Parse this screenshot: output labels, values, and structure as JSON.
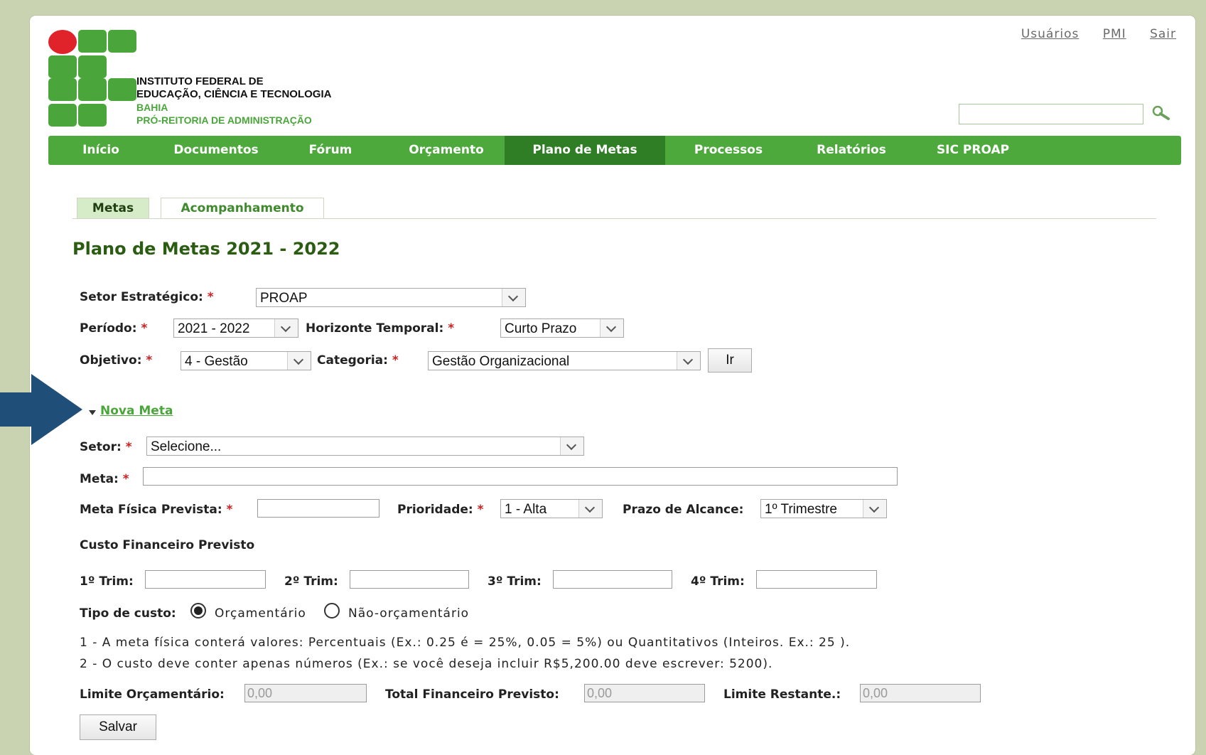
{
  "header": {
    "institution_line1": "INSTITUTO FEDERAL DE",
    "institution_line2": "EDUCAÇÃO, CIÊNCIA E TECNOLOGIA",
    "institution_line3": "BAHIA",
    "department": "PRÓ-REITORIA DE ADMINISTRAÇÃO",
    "top_links": [
      "Usuários",
      "PMI",
      "Sair"
    ],
    "search_value": ""
  },
  "nav": {
    "items": [
      "Início",
      "Documentos",
      "Fórum",
      "Orçamento",
      "Plano de Metas",
      "Processos",
      "Relatórios",
      "SIC PROAP"
    ],
    "active": "Plano de Metas"
  },
  "tabs": [
    "Metas",
    "Acompanhamento"
  ],
  "page_title": "Plano de Metas 2021 - 2022",
  "filters": {
    "setor_label": "Setor Estratégico:",
    "setor_value": "PROAP",
    "periodo_label": "Período:",
    "periodo_value": "2021 - 2022",
    "horizonte_label": "Horizonte Temporal:",
    "horizonte_value": "Curto Prazo",
    "objetivo_label": "Objetivo:",
    "objetivo_value": "4 - Gestão",
    "categoria_label": "Categoria:",
    "categoria_value": "Gestão Organizacional",
    "go_button": "Ir"
  },
  "form": {
    "toggle_label": "Nova Meta",
    "setor_label": "Setor:",
    "setor_value": "Selecione...",
    "meta_label": "Meta:",
    "meta_value": "",
    "meta_fisica_label": "Meta Física Prevista:",
    "meta_fisica_value": "",
    "prioridade_label": "Prioridade:",
    "prioridade_value": "1 - Alta",
    "prazo_label": "Prazo de Alcance:",
    "prazo_value": "1º Trimestre",
    "custo_heading": "Custo Financeiro Previsto",
    "trim_labels": [
      "1º Trim:",
      "2º Trim:",
      "3º Trim:",
      "4º Trim:"
    ],
    "tipo_custo_label": "Tipo de custo:",
    "tipo_options": [
      "Orçamentário",
      "Não-orçamentário"
    ],
    "tipo_selected": "Orçamentário",
    "note1": "1 - A meta física conterá valores: Percentuais (Ex.: 0.25 é = 25%, 0.05 = 5%) ou Quantitativos (Inteiros. Ex.: 25 ).",
    "note2": "2 - O custo deve conter apenas números (Ex.: se você deseja incluir R$5,200.00 deve escrever: 5200).",
    "limite_label": "Limite Orçamentário:",
    "limite_value": "0,00",
    "total_label": "Total Financeiro Previsto:",
    "total_value": "0,00",
    "restante_label": "Limite Restante.:",
    "restante_value": "0,00",
    "save_button": "Salvar"
  },
  "required_mark": "*",
  "colors": {
    "brand_green": "#4ea93d",
    "nav_active": "#2f7d25",
    "logo_red": "#e0232a",
    "arrow": "#1f4e79"
  }
}
